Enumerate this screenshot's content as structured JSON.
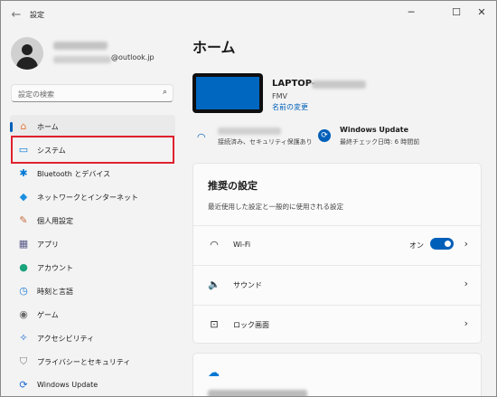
{
  "window": {
    "title": "設定",
    "back": "←",
    "minimize": "─",
    "maximize": "☐",
    "close": "✕"
  },
  "account": {
    "email_domain": "@outlook.jp"
  },
  "search": {
    "placeholder": "設定の検索",
    "icon": "⌕"
  },
  "sidebar": {
    "items": [
      {
        "label": "ホーム",
        "icon": "home-icon",
        "glyph": "⌂",
        "color": "#e8783a"
      },
      {
        "label": "システム",
        "icon": "system-icon",
        "glyph": "▭",
        "color": "#0078d4"
      },
      {
        "label": "Bluetooth とデバイス",
        "icon": "bluetooth-icon",
        "glyph": "✱",
        "color": "#0078d4"
      },
      {
        "label": "ネットワークとインターネット",
        "icon": "network-icon",
        "glyph": "◆",
        "color": "#1a8fe0"
      },
      {
        "label": "個人用設定",
        "icon": "brush-icon",
        "glyph": "✎",
        "color": "#c86a3a"
      },
      {
        "label": "アプリ",
        "icon": "apps-icon",
        "glyph": "▦",
        "color": "#5a5a8a"
      },
      {
        "label": "アカウント",
        "icon": "account-icon",
        "glyph": "●",
        "color": "#1aa37a"
      },
      {
        "label": "時刻と言語",
        "icon": "time-language-icon",
        "glyph": "◷",
        "color": "#1a7ad4"
      },
      {
        "label": "ゲーム",
        "icon": "gaming-icon",
        "glyph": "◉",
        "color": "#6a6a6a"
      },
      {
        "label": "アクセシビリティ",
        "icon": "accessibility-icon",
        "glyph": "✧",
        "color": "#1a6ad4"
      },
      {
        "label": "プライバシーとセキュリティ",
        "icon": "shield-icon",
        "glyph": "⛉",
        "color": "#7a7a7a"
      },
      {
        "label": "Windows Update",
        "icon": "windows-update-icon",
        "glyph": "⟳",
        "color": "#1a6ad4"
      }
    ]
  },
  "main": {
    "title": "ホーム",
    "device": {
      "name": "LAPTOP-",
      "model": "FMV",
      "rename_link": "名前の変更"
    },
    "network": {
      "status": "接続済み、セキュリティ保護あり"
    },
    "update": {
      "title": "Windows Update",
      "status": "最終チェック日時: 6 時間前"
    },
    "recommended": {
      "title": "推奨の設定",
      "subtitle": "最近使用した設定と一般的に使用される設定",
      "rows": [
        {
          "label": "Wi-Fi",
          "icon": "wifi-icon",
          "glyph": "◠",
          "state": "オン"
        },
        {
          "label": "サウンド",
          "icon": "speaker-icon",
          "glyph": "🔈"
        },
        {
          "label": "ロック画面",
          "icon": "lock-screen-icon",
          "glyph": "⊡"
        }
      ]
    },
    "chevron": "›"
  },
  "colors": {
    "accent": "#005fb8",
    "highlight_box": "#e0212e"
  }
}
